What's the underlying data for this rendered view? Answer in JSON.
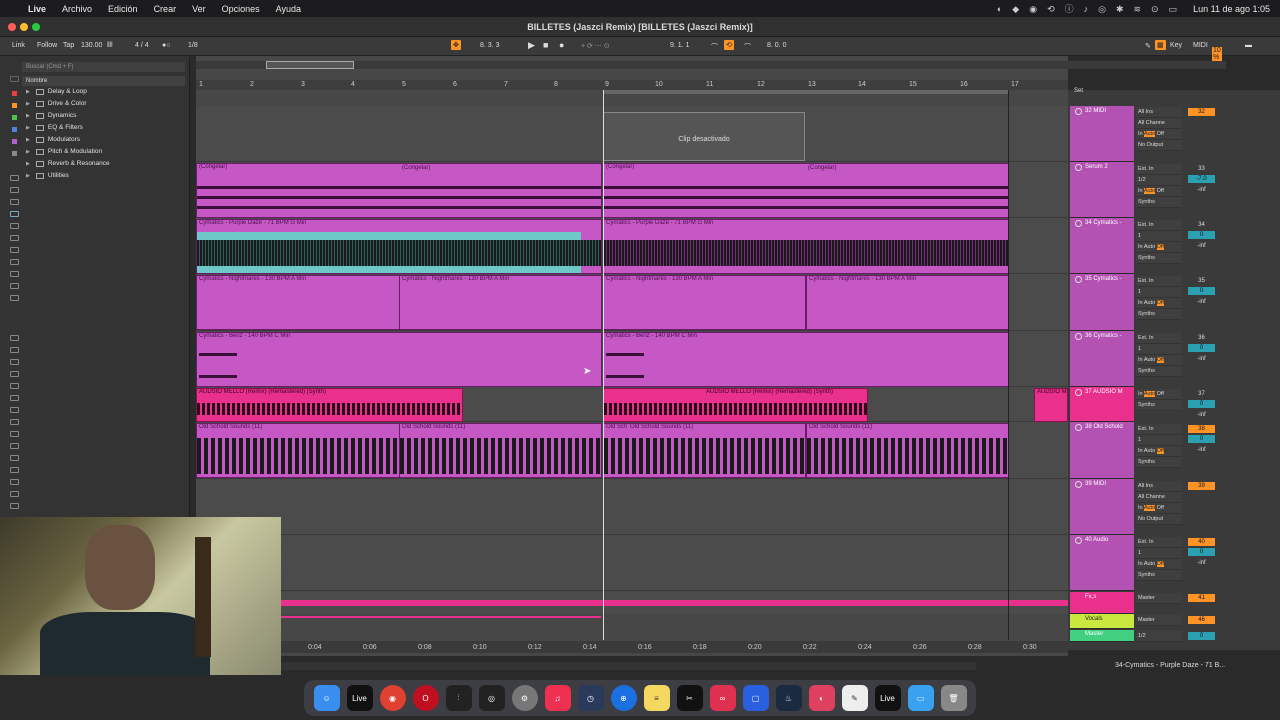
{
  "menubar": {
    "items": [
      "Live",
      "Archivo",
      "Edición",
      "Crear",
      "Ver",
      "Opciones",
      "Ayuda"
    ],
    "datetime": "Lun 11 de ago  1:05"
  },
  "window": {
    "title": "BILLETES (Jaszci Remix)  [BILLETES (Jaszci Remix)]"
  },
  "transport": {
    "link": "Link",
    "follow": "Follow",
    "tap": "Tap",
    "tempo": "130.00",
    "signature": "4 / 4",
    "quantize": "1/8",
    "position": "8.  3.  3",
    "loop_start": "9.  1.  1",
    "loop_length": "8.  0.  0",
    "key": "Key",
    "midi": "MIDI",
    "cpu": "10 %"
  },
  "browser": {
    "search_placeholder": "Buscar (Cmd + F)",
    "header": "Nombre",
    "items": [
      "Delay & Loop",
      "Drive & Color",
      "Dynamics",
      "EQ & Filters",
      "Modulators",
      "Pitch & Modulation",
      "Reverb & Resonance",
      "Utilities"
    ]
  },
  "ruler": {
    "bars": [
      "1",
      "2",
      "3",
      "4",
      "5",
      "6",
      "7",
      "8",
      "9",
      "10",
      "11",
      "12",
      "13",
      "14",
      "15",
      "16",
      "17"
    ]
  },
  "time_axis": {
    "labels": [
      "0:04",
      "0:06",
      "0:08",
      "0:10",
      "0:12",
      "0:14",
      "0:16",
      "0:18",
      "0:20",
      "0:22",
      "0:24",
      "0:26",
      "0:28",
      "0:30"
    ]
  },
  "arrangement": {
    "deactivated_clip": "Clip desactivado",
    "clips": {
      "congelar": "(Congelar)",
      "purple": "Cymatics - Purple Daze - 71 BPM G Min",
      "nightmares": "Cymatics - Nightmares - 130 BPM A Min",
      "benz": "Cymatics - Benz - 140 BPM C Min",
      "audsio": "AUDSIO MELLO (Remix) (Remastered) (Synth)",
      "audsio_short": "AUDSIO M",
      "oldschool": "Old Schold Sounds  (11)",
      "oldschool_short": "Old Sch"
    }
  },
  "set_label": "Set",
  "tracks": [
    {
      "name": "32 MIDI",
      "in": "All Ins",
      "ch": "All Channe",
      "mon": "Auto",
      "out": "No Output",
      "num": "32"
    },
    {
      "name": "Serum 2",
      "in": "Ext. In",
      "ch": "1/2",
      "mon": "Auto",
      "out": "Synths",
      "num": "33",
      "vol": "-7.0",
      "pan": "C",
      "meter": "-inf"
    },
    {
      "name": "34 Cymatics -",
      "in": "Ext. In",
      "ch": "1",
      "mon": "Auto",
      "out": "Synths",
      "num": "34",
      "vol": "0",
      "pan": "C",
      "meter": "-inf"
    },
    {
      "name": "35 Cymatics -",
      "in": "Ext. In",
      "ch": "1",
      "mon": "Auto",
      "out": "Synths",
      "num": "35",
      "vol": "0",
      "pan": "C",
      "meter": "-inf"
    },
    {
      "name": "36 Cymatics -",
      "in": "Ext. In",
      "ch": "1",
      "mon": "Auto",
      "out": "Synths",
      "num": "36",
      "vol": "0",
      "pan": "C",
      "meter": "-inf"
    },
    {
      "name": "37 AUDSIO M",
      "in": "In",
      "ch": "",
      "mon": "Auto",
      "out": "Synths",
      "num": "37",
      "vol": "0",
      "pan": "C",
      "meter": "-inf"
    },
    {
      "name": "38 Old Schold",
      "in": "Ext. In",
      "ch": "1",
      "mon": "Auto",
      "out": "Synths",
      "num": "38",
      "vol": "0",
      "pan": "C",
      "meter": "-inf"
    },
    {
      "name": "39 MIDI",
      "in": "All Ins",
      "ch": "All Channe",
      "mon": "Auto",
      "out": "No Output",
      "num": "39"
    },
    {
      "name": "40 Audio",
      "in": "Ext. In",
      "ch": "1",
      "mon": "Auto",
      "out": "Synths",
      "num": "40",
      "vol": "0",
      "pan": "C",
      "meter": "-inf"
    }
  ],
  "returns": [
    {
      "name": "Fx,s",
      "out": "Master",
      "num": "41"
    },
    {
      "name": "Vocals",
      "out": "Master",
      "num": "46"
    },
    {
      "name": "Master",
      "out": "1/2",
      "num": "0"
    }
  ],
  "status": {
    "text": "34-Cymatics - Purple Daze - 71 B..."
  },
  "dock": [
    "Finder",
    "Live",
    "Chrome",
    "Opera",
    "Mixer",
    "Tuner",
    "Settings",
    "Music",
    "Find My",
    "Safari",
    "Notes",
    "CapCut",
    "Creative Cloud",
    "Notchmeister",
    "Steam",
    "Adobe",
    "Script",
    "Live",
    "Files",
    "Trash"
  ],
  "colors": {
    "clip": "#c050c0",
    "clip_light": "#d27ad2",
    "pink": "#e8308c",
    "teal": "#6ec8c8",
    "orange": "#ff9326"
  }
}
